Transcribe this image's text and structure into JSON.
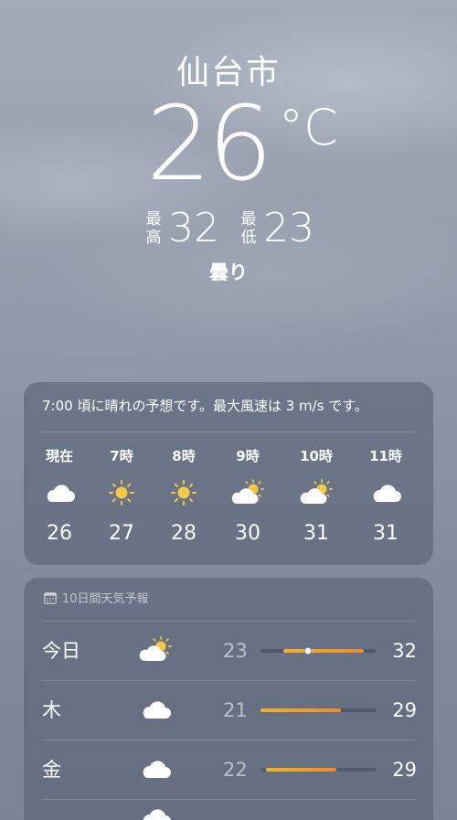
{
  "location": {
    "city": "仙台市",
    "current_temp": "26",
    "unit": "°C",
    "high_label_1": "最",
    "high_label_2": "高",
    "high": "32",
    "low_label_1": "最",
    "low_label_2": "低",
    "low": "23",
    "condition": "曇り"
  },
  "hourly": {
    "summary": "7:00 頃に晴れの予想です。最大風速は 3 m/s です。",
    "items": [
      {
        "time": "現在",
        "icon": "cloud-icon",
        "temp": "26"
      },
      {
        "time": "7時",
        "icon": "sun-icon",
        "temp": "27"
      },
      {
        "time": "8時",
        "icon": "sun-icon",
        "temp": "28"
      },
      {
        "time": "9時",
        "icon": "partly-sunny-icon",
        "temp": "30"
      },
      {
        "time": "10時",
        "icon": "partly-sunny-icon",
        "temp": "31"
      },
      {
        "time": "11時",
        "icon": "cloud-icon",
        "temp": "31"
      }
    ]
  },
  "daily": {
    "header": "10日間天気予報",
    "days": [
      {
        "name": "今日",
        "icon": "partly-sunny-icon",
        "low": "23",
        "high": "32",
        "range_start": 0.2,
        "range_end": 0.9,
        "current": 0.41
      },
      {
        "name": "木",
        "icon": "cloud-icon",
        "low": "21",
        "high": "29",
        "range_start": 0.0,
        "range_end": 0.7
      },
      {
        "name": "金",
        "icon": "cloud-icon",
        "low": "22",
        "high": "29",
        "range_start": 0.05,
        "range_end": 0.66
      }
    ]
  },
  "colors": {
    "sun": "#f7c843",
    "bar_start": "#f3b32b",
    "bar_end": "#ee8a2a"
  }
}
